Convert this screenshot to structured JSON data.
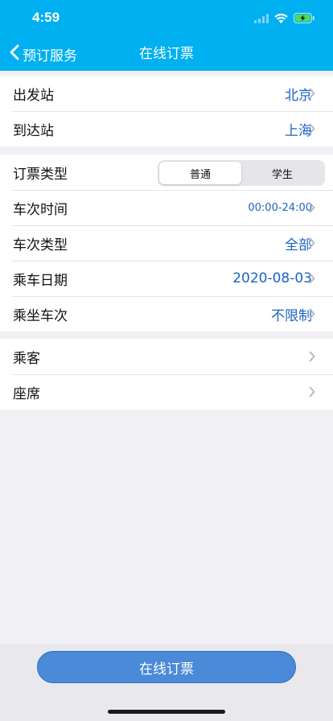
{
  "status_bar": {
    "time": "4:59"
  },
  "nav": {
    "back_label": "预订服务",
    "title": "在线订票"
  },
  "route": {
    "departure_label": "出发站",
    "departure_value": "北京",
    "arrival_label": "到达站",
    "arrival_value": "上海"
  },
  "ticket": {
    "type_label": "订票类型",
    "type_options": [
      "普通",
      "学生"
    ],
    "type_selected": "普通",
    "time_label": "车次时间",
    "time_value": "00:00-24:00",
    "train_type_label": "车次类型",
    "train_type_value": "全部",
    "date_label": "乘车日期",
    "date_value": "2020-08-03",
    "train_label": "乘坐车次",
    "train_value": "不限制"
  },
  "extras": {
    "passenger_label": "乘客",
    "seat_label": "座席"
  },
  "footer": {
    "button_label": "在线订票"
  },
  "colors": {
    "header": "#00b0f0",
    "accent": "#1a63c4",
    "button": "#4a8ad8",
    "background": "#f0f0f5"
  }
}
